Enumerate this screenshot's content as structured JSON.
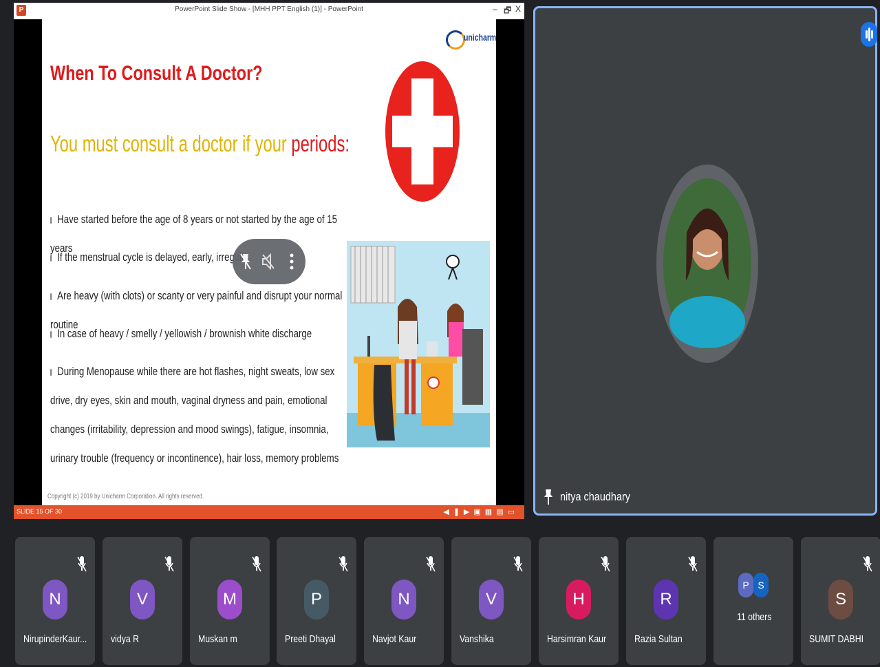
{
  "window": {
    "title": "PowerPoint Slide Show - [MHH PPT English (1)] - PowerPoint",
    "minimize": "–",
    "restore": "🗗",
    "close": "X",
    "app_logo": "P"
  },
  "slide": {
    "brand": "unicharm",
    "heading": "When To Consult A Doctor?",
    "subheading_part1": "You must consult a doctor if your ",
    "subheading_part2": "periods:",
    "bullets": [
      "Have started before the age of 8 years or not started by the age of 15 years",
      "If the menstrual cycle is delayed, early, irregular",
      "Are heavy (with clots) or scanty or very painful and disrupt your normal routine",
      "In case of heavy / smelly / yellowish / brownish white discharge",
      "During Menopause while there are hot flashes, night sweats,  low sex drive, dry eyes, skin and mouth, vaginal dryness and pain, emotional changes (irritability, depression and mood swings), fatigue, insomnia, urinary trouble (frequency or incontinence), hair loss, memory problems"
    ],
    "copyright": "Copyright (c) 2019 by Unicharm Corporation. All rights reserved."
  },
  "statusbar": {
    "slide_indicator": "SLIDE 15 OF 30"
  },
  "speaker": {
    "name": "nitya chaudhary"
  },
  "participants": [
    {
      "initial": "N",
      "name": "NirupinderKaur...",
      "color": "#7e57c2"
    },
    {
      "initial": "V",
      "name": "vidya R",
      "color": "#7e57c2"
    },
    {
      "initial": "M",
      "name": "Muskan m",
      "color": "#9c4dcc"
    },
    {
      "initial": "P",
      "name": "Preeti Dhayal",
      "color": "#455a64"
    },
    {
      "initial": "N",
      "name": "Navjot Kaur",
      "color": "#7e57c2"
    },
    {
      "initial": "V",
      "name": "Vanshika",
      "color": "#7e57c2"
    },
    {
      "initial": "H",
      "name": "Harsimran Kaur",
      "color": "#d81b60"
    },
    {
      "initial": "R",
      "name": "Razia Sultan",
      "color": "#5e35b1"
    },
    {
      "initial": "S",
      "name": "SUMIT DABHI",
      "color": "#6d4c41"
    }
  ],
  "others": {
    "label": "11 others",
    "initials": [
      "P",
      "S"
    ],
    "colors": [
      "#5c6bc0",
      "#1565c0"
    ]
  },
  "colors": {
    "accent": "#8ab4f8",
    "tile_bg": "#3c4043",
    "page_bg": "#202124",
    "slide_red": "#e0191b",
    "slide_yellow": "#e0b300",
    "statusbar": "#e2522b"
  }
}
